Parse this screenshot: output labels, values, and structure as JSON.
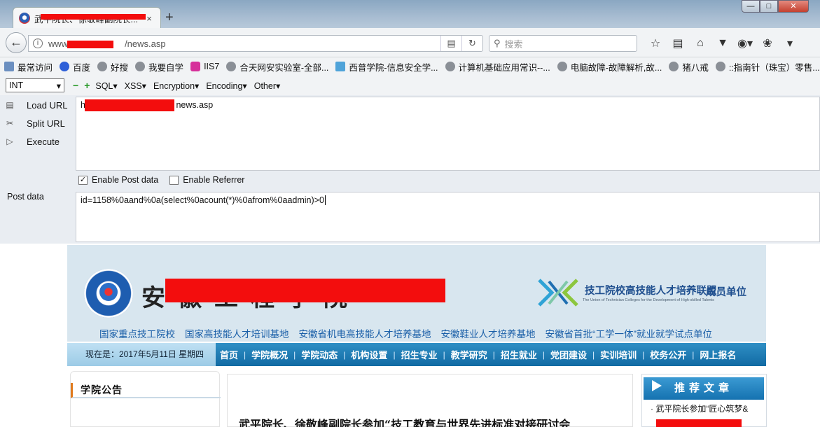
{
  "browser": {
    "tab_title": "武平院长、徐敬峰副院长...",
    "tab_close": "×",
    "new_tab": "+",
    "window_controls": [
      "—",
      "□",
      "✕"
    ],
    "url_prefix": "www.",
    "url_suffix": "/news.asp",
    "search_placeholder": "搜索",
    "nav_icons": [
      "star-icon",
      "reader-icon",
      "home-icon",
      "pocket-icon",
      "addon-icon",
      "bug-icon",
      "menu-icon"
    ]
  },
  "bookmarks": [
    {
      "label": "最常访问",
      "icon": "history-icon"
    },
    {
      "label": "百度",
      "icon": "baidu-icon"
    },
    {
      "label": "好搜",
      "icon": "globe-icon"
    },
    {
      "label": "我要自学",
      "icon": "globe-icon"
    },
    {
      "label": "IIS7",
      "icon": "iis-icon"
    },
    {
      "label": "合天网安实验室-全部...",
      "icon": "globe-icon"
    },
    {
      "label": "西普学院-信息安全学...",
      "icon": "image-icon"
    },
    {
      "label": "计算机基础应用常识--...",
      "icon": "globe-icon"
    },
    {
      "label": "电脑故障-故障解析,故...",
      "icon": "globe-icon"
    },
    {
      "label": "猪八戒",
      "icon": "globe-icon"
    },
    {
      "label": "::指南针（珠宝）零售...",
      "icon": "globe-icon"
    }
  ],
  "hackbar": {
    "type_select": "INT",
    "minus": "−",
    "plus": "+",
    "menus": [
      "SQL▾",
      "XSS▾",
      "Encryption▾",
      "Encoding▾",
      "Other▾"
    ],
    "load_url": "Load URL",
    "split_url": "Split URL",
    "execute": "Execute",
    "url_prefix": "ht",
    "url_suffix": "news.asp",
    "enable_post": "Enable Post data",
    "enable_post_checked": true,
    "enable_referrer": "Enable Referrer",
    "enable_referrer_checked": false,
    "post_label": "Post data",
    "post_value": "id=1158%0aand%0a(select%0acount(*)%0afrom%0aadmin)>0"
  },
  "site": {
    "alliance_cn": "技工院校高技能人才培养联盟",
    "alliance_member": "成员单位",
    "alliance_en": "The Union of Technician Colleges for the Development of High-skilled Talents",
    "tags": [
      "国家重点技工院校",
      "国家高技能人才培训基地",
      "安徽省机电高技能人才培养基地",
      "安徽鞋业人才培养基地",
      "安徽省首批“工学一体”就业就学试点单位"
    ],
    "date_text": "现在是：2017年5月11日 星期四",
    "nav": [
      "首页",
      "学院概况",
      "学院动态",
      "机构设置",
      "招生专业",
      "教学研究",
      "招生就业",
      "党团建设",
      "实训培训",
      "校务公开",
      "网上报名"
    ],
    "announce_title": "学院公告",
    "headline": "武平院长、徐敬峰副院长参加“技工教育与世界先进标准对接研讨会",
    "recommend_title": "推荐文章",
    "recommend_items": [
      "· 武平院长参加“匠心筑梦&"
    ]
  },
  "colors": {
    "redaction": "#f30d0d",
    "nav_blue": "#116aa3",
    "link_blue": "#1a5fa8",
    "accent_orange": "#e07b1e"
  }
}
